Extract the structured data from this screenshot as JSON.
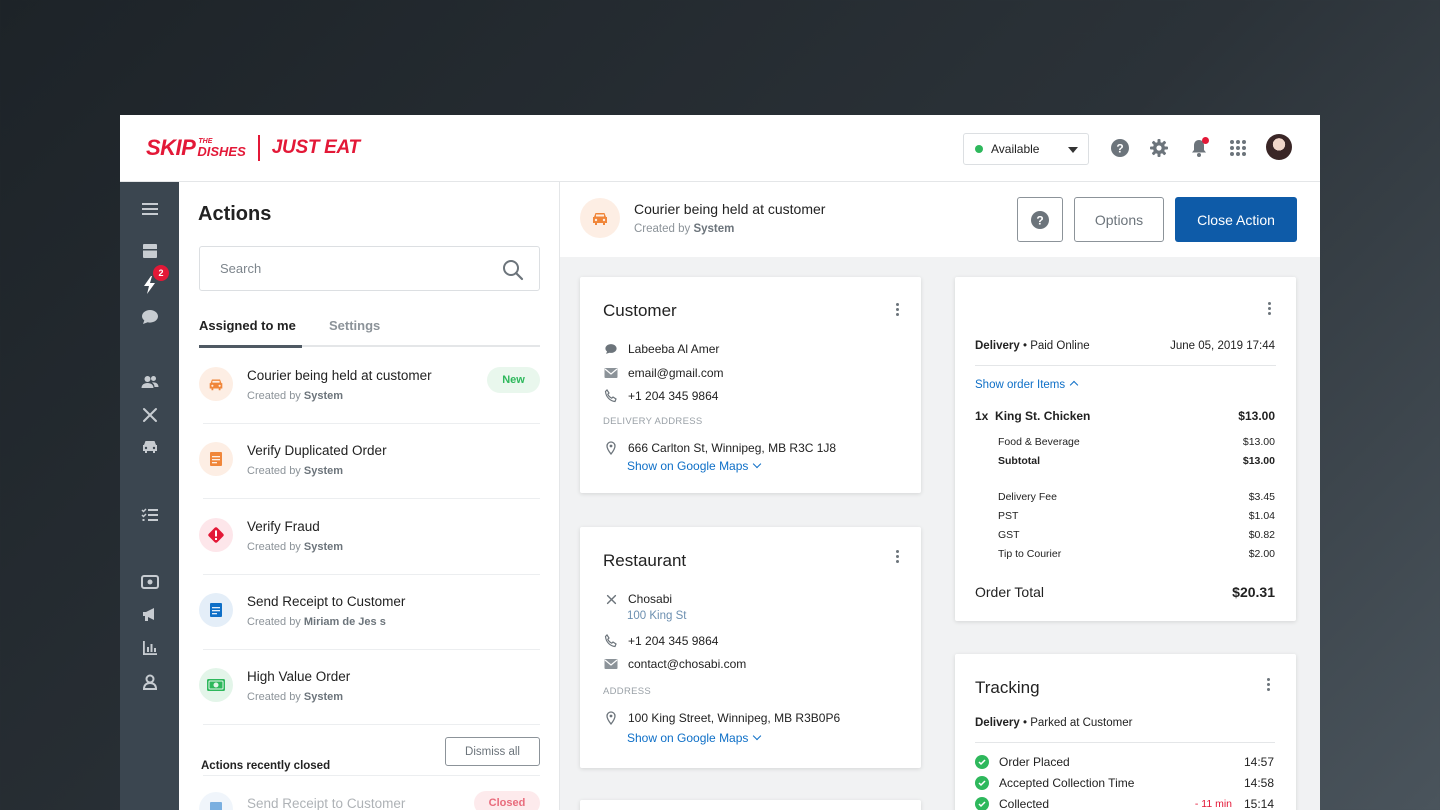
{
  "header": {
    "logo": {
      "skip": "SKIP",
      "the": "THE",
      "dishes": "DISHES",
      "just_eat": "JUST EAT"
    },
    "status": "Available",
    "icons": [
      "help-icon",
      "gear-icon",
      "bell-icon",
      "apps-grid-icon"
    ],
    "colors": {
      "brand": "#e31837",
      "available": "#2eb85c",
      "primary": "#0e5ba8"
    }
  },
  "sidenav": {
    "items": [
      "menu-icon",
      "orders-icon",
      "actions-icon",
      "chat-icon",
      "customers-icon",
      "restaurants-icon",
      "couriers-icon",
      "tasks-icon",
      "payments-icon",
      "campaigns-icon",
      "reports-icon",
      "admin-icon"
    ],
    "actions_badge": "2"
  },
  "actions": {
    "title": "Actions",
    "search_placeholder": "Search",
    "tabs": {
      "assigned": "Assigned to me",
      "settings": "Settings"
    },
    "created_prefix": "Created by",
    "items": [
      {
        "title": "Courier being held at customer",
        "by": "System",
        "badge": "New",
        "icon": "car-icon"
      },
      {
        "title": "Verify Duplicated Order",
        "by": "System",
        "icon": "document-icon"
      },
      {
        "title": "Verify Fraud",
        "by": "System",
        "icon": "alert-icon"
      },
      {
        "title": "Send Receipt to Customer",
        "by": "Miriam de Jes  s",
        "icon": "receipt-icon"
      },
      {
        "title": "High Value Order",
        "by": "System",
        "icon": "money-icon"
      }
    ],
    "recent_label": "Actions recently closed",
    "dismiss_all": "Dismiss all",
    "recent_items": [
      {
        "title": "Send Receipt to Customer",
        "badge": "Closed"
      }
    ]
  },
  "main": {
    "title": "Courier being held at customer",
    "created_prefix": "Created by",
    "created_by": "System",
    "options": "Options",
    "close_action": "Close Action",
    "customer": {
      "title": "Customer",
      "name": "Labeeba Al Amer",
      "email": "email@gmail.com",
      "phone": "+1 204 345 9864",
      "address_label": "DELIVERY ADDRESS",
      "address": "666 Carlton St, Winnipeg, MB R3C 1J8",
      "maps_link": "Show on Google Maps"
    },
    "restaurant": {
      "title": "Restaurant",
      "name": "Chosabi",
      "street": "100 King St",
      "phone": "+1 204 345 9864",
      "email": "contact@chosabi.com",
      "address_label": "ADDRESS",
      "address": "100 King Street, Winnipeg, MB R3B0P6",
      "maps_link": "Show on Google Maps"
    },
    "order": {
      "type": "Delivery",
      "payment": "Paid Online",
      "date": "June 05, 2019 17:44",
      "show_items": "Show order Items",
      "item": {
        "qty": "1x",
        "name": "King St. Chicken",
        "price": "$13.00"
      },
      "lines": [
        {
          "label": "Food & Beverage",
          "value": "$13.00"
        },
        {
          "label": "Subtotal",
          "value": "$13.00"
        },
        {
          "label": "Delivery Fee",
          "value": "$3.45"
        },
        {
          "label": "PST",
          "value": "$1.04"
        },
        {
          "label": "GST",
          "value": "$0.82"
        },
        {
          "label": "Tip to Courier",
          "value": "$2.00"
        }
      ],
      "total_label": "Order Total",
      "total": "$20.31"
    },
    "tracking": {
      "title": "Tracking",
      "type": "Delivery",
      "status": "Parked at Customer",
      "steps": [
        {
          "label": "Order Placed",
          "time": "14:57"
        },
        {
          "label": "Accepted Collection Time",
          "time": "14:58"
        },
        {
          "label": "Collected",
          "time": "15:14",
          "delta": "- 11 min"
        }
      ]
    }
  }
}
